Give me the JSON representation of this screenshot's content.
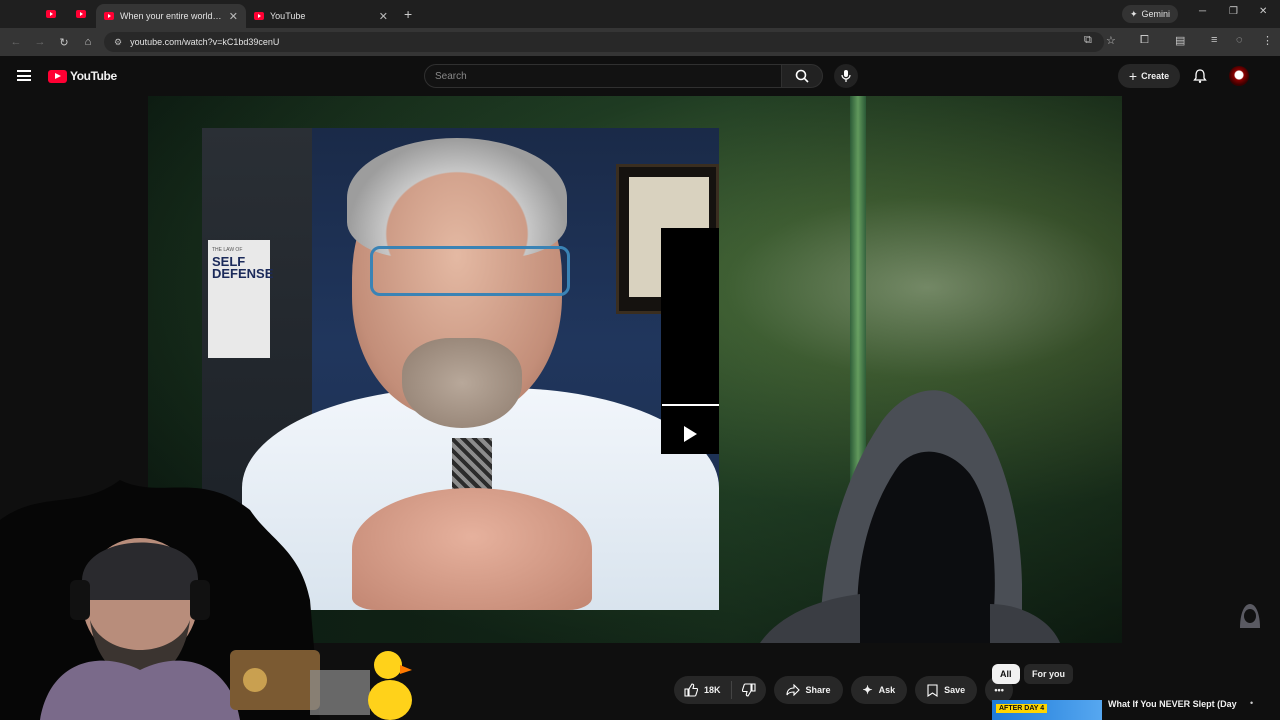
{
  "browser": {
    "tabs": [
      {
        "title": "",
        "state": "mini"
      },
      {
        "title": "",
        "state": "mini"
      },
      {
        "title": "When your entire worldview FA",
        "state": "active"
      },
      {
        "title": "YouTube",
        "state": "inactive"
      }
    ],
    "gemini_label": "Gemini",
    "url": "youtube.com/watch?v=kC1bd39cenU"
  },
  "youtube": {
    "logo_text": "YouTube",
    "search_placeholder": "Search",
    "create_label": "Create"
  },
  "video": {
    "book_title_line1": "SELF",
    "book_title_line2": "DEFENSE",
    "book_small": "THE LAW OF"
  },
  "actions": {
    "like_count": "18K",
    "share_label": "Share",
    "ask_label": "Ask",
    "save_label": "Save",
    "more_label": "•••"
  },
  "sidebar": {
    "chips": [
      "All",
      "For you"
    ],
    "recommendation": {
      "badge": "AFTER DAY 4",
      "title": "What If You NEVER Slept (Day"
    }
  },
  "colors": {
    "youtube_red": "#ff0033",
    "background": "#0f0f0f",
    "pill": "#272727"
  }
}
